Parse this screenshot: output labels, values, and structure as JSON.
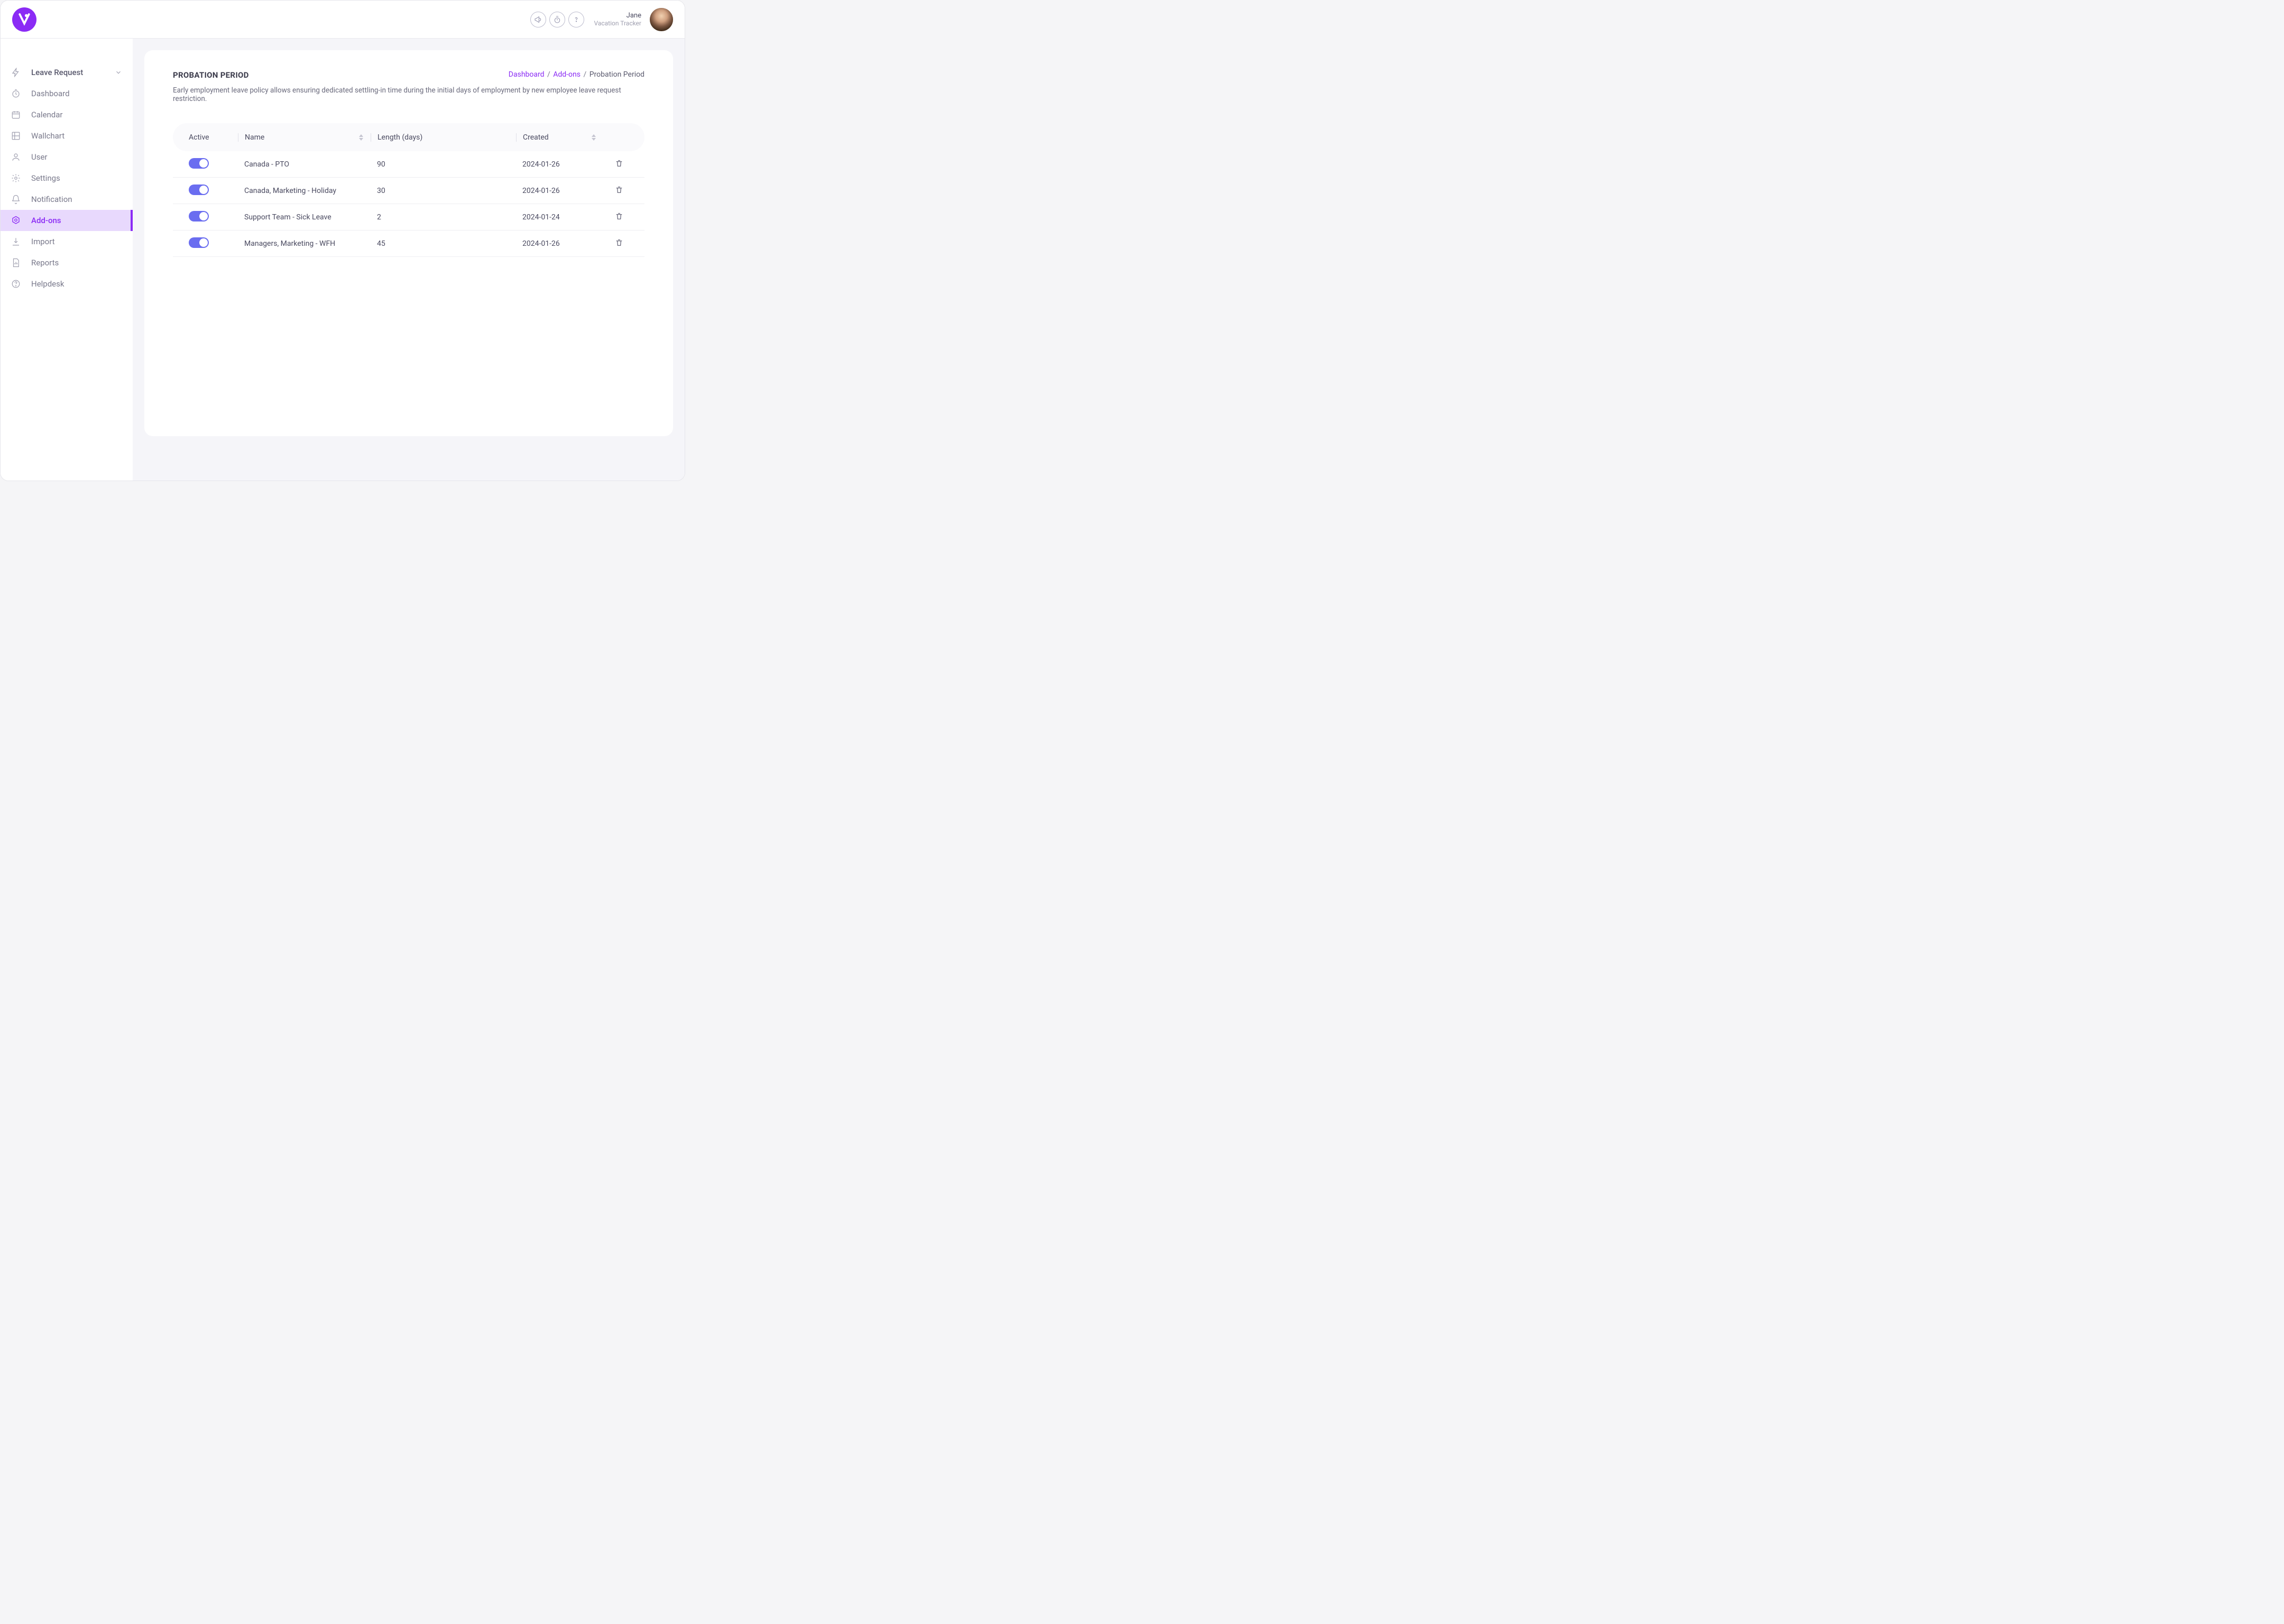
{
  "header": {
    "user_name": "Jane",
    "user_sub": "Vacation Tracker"
  },
  "sidebar": {
    "items": [
      {
        "label": "Leave Request",
        "icon": "lightning-icon",
        "expandable": true
      },
      {
        "label": "Dashboard",
        "icon": "clock-icon"
      },
      {
        "label": "Calendar",
        "icon": "calendar-icon"
      },
      {
        "label": "Wallchart",
        "icon": "grid-icon"
      },
      {
        "label": "User",
        "icon": "user-icon"
      },
      {
        "label": "Settings",
        "icon": "gear-icon"
      },
      {
        "label": "Notification",
        "icon": "bell-icon"
      },
      {
        "label": "Add-ons",
        "icon": "addon-icon",
        "active": true
      },
      {
        "label": "Import",
        "icon": "download-icon"
      },
      {
        "label": "Reports",
        "icon": "report-icon"
      },
      {
        "label": "Helpdesk",
        "icon": "help-icon"
      }
    ]
  },
  "page": {
    "title": "PROBATION PERIOD",
    "description": "Early employment leave policy allows ensuring dedicated settling-in time during the initial days of employment by new employee leave request restriction.",
    "breadcrumb": {
      "dashboard": "Dashboard",
      "addons": "Add-ons",
      "current": "Probation Period"
    },
    "columns": {
      "active": "Active",
      "name": "Name",
      "length": "Length (days)",
      "created": "Created"
    },
    "rows": [
      {
        "active": true,
        "name": "Canada - PTO",
        "length": "90",
        "created": "2024-01-26"
      },
      {
        "active": true,
        "name": "Canada, Marketing - Holiday",
        "length": "30",
        "created": "2024-01-26"
      },
      {
        "active": true,
        "name": "Support Team - Sick Leave",
        "length": "2",
        "created": "2024-01-24"
      },
      {
        "active": true,
        "name": "Managers, Marketing - WFH",
        "length": "45",
        "created": "2024-01-26"
      }
    ]
  }
}
